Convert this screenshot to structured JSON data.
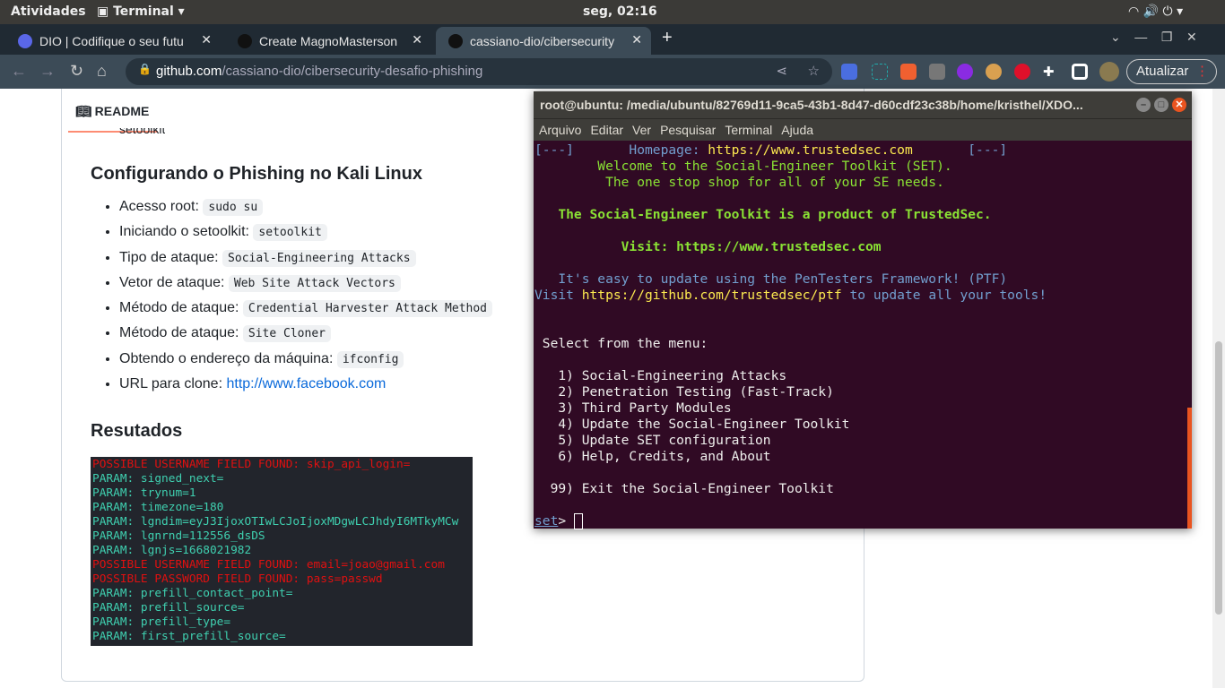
{
  "system": {
    "activities": "Atividades",
    "app": "Terminal",
    "clock": "seg, 02:16"
  },
  "browser": {
    "tabs": [
      {
        "label": "DIO | Codifique o seu futu"
      },
      {
        "label": "Create MagnoMasterson"
      },
      {
        "label": "cassiano-dio/cibersecurity"
      }
    ],
    "url_host": "github.com",
    "url_path": "/cassiano-dio/cibersecurity-desafio-phishing",
    "update_label": "Atualizar"
  },
  "readme": {
    "tab_label": "README",
    "cut_text": "setoolkit",
    "heading1": "Configurando o Phishing no Kali Linux",
    "items": [
      {
        "label": "Acesso root: ",
        "code": "sudo su"
      },
      {
        "label": "Iniciando o setoolkit: ",
        "code": "setoolkit"
      },
      {
        "label": "Tipo de ataque: ",
        "code": "Social-Engineering Attacks"
      },
      {
        "label": "Vetor de ataque: ",
        "code": "Web Site Attack Vectors"
      },
      {
        "label": "Método de ataque: ",
        "code": "Credential Harvester Attack Method"
      },
      {
        "label": "Método de ataque: ",
        "code": "Site Cloner"
      },
      {
        "label": "Obtendo o endereço da máquina: ",
        "code": "ifconfig"
      }
    ],
    "url_item_label": "URL para clone: ",
    "url_item_link": "http://www.facebook.com",
    "heading2": "Resutados",
    "results": [
      {
        "c": "r",
        "t": "POSSIBLE USERNAME FIELD FOUND: skip_api_login="
      },
      {
        "c": "g",
        "t": "PARAM: signed_next="
      },
      {
        "c": "g",
        "t": "PARAM: trynum=1"
      },
      {
        "c": "g",
        "t": "PARAM: timezone=180"
      },
      {
        "c": "g",
        "t": "PARAM: lgndim=eyJ3IjoxOTIwLCJoIjoxMDgwLCJhdyI6MTkyMCw"
      },
      {
        "c": "g",
        "t": "PARAM: lgnrnd=112556_dsDS"
      },
      {
        "c": "g",
        "t": "PARAM: lgnjs=1668021982"
      },
      {
        "c": "r",
        "t": "POSSIBLE USERNAME FIELD FOUND: email=joao@gmail.com"
      },
      {
        "c": "r",
        "t": "POSSIBLE PASSWORD FIELD FOUND: pass=passwd"
      },
      {
        "c": "g",
        "t": "PARAM: prefill_contact_point="
      },
      {
        "c": "g",
        "t": "PARAM: prefill_source="
      },
      {
        "c": "g",
        "t": "PARAM: prefill_type="
      },
      {
        "c": "g",
        "t": "PARAM: first_prefill_source="
      }
    ]
  },
  "terminal": {
    "title": "root@ubuntu: /media/ubuntu/82769d11-9ca5-43b1-8d47-d60cdf23c38b/home/kristhel/XDO...",
    "menu": [
      "Arquivo",
      "Editar",
      "Ver",
      "Pesquisar",
      "Terminal",
      "Ajuda"
    ],
    "lines": [
      [
        {
          "c": "blue",
          "t": "[---]       Homepage: "
        },
        {
          "c": "yellow",
          "t": "https://www.trustedsec.com"
        },
        {
          "c": "blue",
          "t": "       [---]"
        }
      ],
      [
        {
          "c": "green",
          "t": "        Welcome to the Social-Engineer Toolkit (SET)."
        }
      ],
      [
        {
          "c": "green",
          "t": "         The one stop shop for all of your SE needs."
        }
      ],
      [],
      [
        {
          "c": "green-b",
          "t": "   The Social-Engineer Toolkit is a product of TrustedSec."
        }
      ],
      [],
      [
        {
          "c": "green-b",
          "t": "           Visit: https://www.trustedsec.com"
        }
      ],
      [],
      [
        {
          "c": "blue",
          "t": "   It's easy to update using the PenTesters Framework! (PTF)"
        }
      ],
      [
        {
          "c": "blue",
          "t": "Visit "
        },
        {
          "c": "yellow",
          "t": "https://github.com/trustedsec/ptf"
        },
        {
          "c": "blue",
          "t": " to update all your tools!"
        }
      ],
      [],
      [],
      [
        {
          "c": "white",
          "t": " Select from the menu:"
        }
      ],
      [],
      [
        {
          "c": "white",
          "t": "   1) Social-Engineering Attacks"
        }
      ],
      [
        {
          "c": "white",
          "t": "   2) Penetration Testing (Fast-Track)"
        }
      ],
      [
        {
          "c": "white",
          "t": "   3) Third Party Modules"
        }
      ],
      [
        {
          "c": "white",
          "t": "   4) Update the Social-Engineer Toolkit"
        }
      ],
      [
        {
          "c": "white",
          "t": "   5) Update SET configuration"
        }
      ],
      [
        {
          "c": "white",
          "t": "   6) Help, Credits, and About"
        }
      ],
      [],
      [
        {
          "c": "white",
          "t": "  99) Exit the Social-Engineer Toolkit"
        }
      ],
      []
    ],
    "prompt": "set",
    "prompt_suffix": "> "
  }
}
